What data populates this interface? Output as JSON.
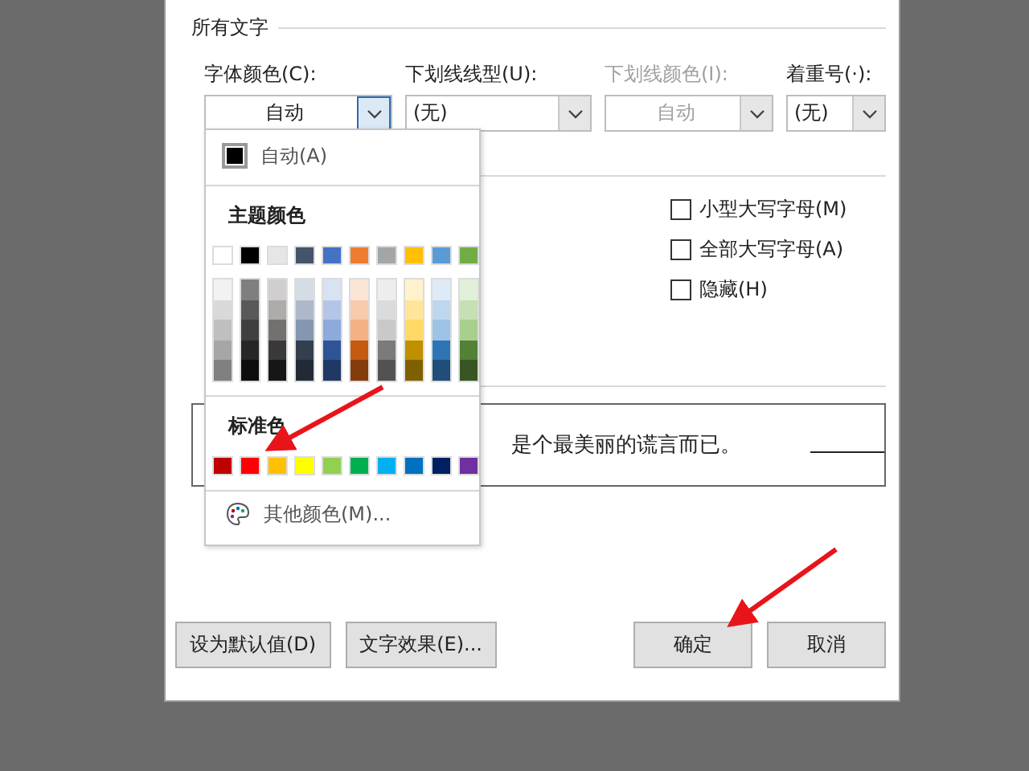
{
  "all_text": {
    "heading": "所有文字",
    "combos": [
      {
        "label": "字体颜色(C):",
        "value": "自动",
        "disabled": false,
        "focused": true,
        "centered": true
      },
      {
        "label": "下划线线型(U):",
        "value": "(无)",
        "disabled": false,
        "focused": false,
        "centered": false
      },
      {
        "label": "下划线颜色(I):",
        "value": "自动",
        "disabled": true,
        "focused": false,
        "centered": true
      },
      {
        "label": "着重号(·):",
        "value": "(无)",
        "disabled": false,
        "focused": false,
        "centered": false
      }
    ]
  },
  "effects": {
    "checkboxes": [
      {
        "label": "小型大写字母(M)",
        "checked": false
      },
      {
        "label": "全部大写字母(A)",
        "checked": false
      },
      {
        "label": "隐藏(H)",
        "checked": false
      }
    ]
  },
  "preview": {
    "text": "是个最美丽的谎言而已。"
  },
  "buttons": [
    {
      "label": "设为默认值(D)",
      "kind": "left"
    },
    {
      "label": "文字效果(E)...",
      "kind": "left"
    },
    {
      "label": "确定",
      "kind": "right"
    },
    {
      "label": "取消",
      "kind": "right"
    }
  ],
  "color_menu": {
    "auto": {
      "label": "自动(A)",
      "color": "#000000"
    },
    "theme_heading": "主题颜色",
    "theme": [
      {
        "color": "#ffffff",
        "shades": [
          {
            "color": "#f2f2f2"
          },
          {
            "color": "#d9d9d9"
          },
          {
            "color": "#bfbfbf"
          },
          {
            "color": "#a6a6a6"
          },
          {
            "color": "#808080"
          }
        ]
      },
      {
        "color": "#000000",
        "shades": [
          {
            "color": "#7f7f7f"
          },
          {
            "color": "#595959"
          },
          {
            "color": "#3f3f3f"
          },
          {
            "color": "#262626"
          },
          {
            "color": "#0d0d0d"
          }
        ]
      },
      {
        "color": "#e7e6e6",
        "shades": [
          {
            "color": "#d0cece"
          },
          {
            "color": "#aeabab"
          },
          {
            "color": "#757070"
          },
          {
            "color": "#3a3838"
          },
          {
            "color": "#171616"
          }
        ]
      },
      {
        "color": "#44546a",
        "shades": [
          {
            "color": "#d6dce4"
          },
          {
            "color": "#adb9ca"
          },
          {
            "color": "#8496b0"
          },
          {
            "color": "#333f4f"
          },
          {
            "color": "#222a35"
          }
        ]
      },
      {
        "color": "#4472c4",
        "shades": [
          {
            "color": "#d9e2f3"
          },
          {
            "color": "#b4c6e7"
          },
          {
            "color": "#8eaadb"
          },
          {
            "color": "#2f5496"
          },
          {
            "color": "#1f3864"
          }
        ]
      },
      {
        "color": "#ed7d31",
        "shades": [
          {
            "color": "#fbe5d5"
          },
          {
            "color": "#f7cbac"
          },
          {
            "color": "#f4b183"
          },
          {
            "color": "#c55a11"
          },
          {
            "color": "#843c0b"
          }
        ]
      },
      {
        "color": "#a5a5a5",
        "shades": [
          {
            "color": "#ededed"
          },
          {
            "color": "#dbdbdb"
          },
          {
            "color": "#c9c9c9"
          },
          {
            "color": "#7b7b7b"
          },
          {
            "color": "#525252"
          }
        ]
      },
      {
        "color": "#ffc000",
        "shades": [
          {
            "color": "#fff2cc"
          },
          {
            "color": "#fee599"
          },
          {
            "color": "#ffd965"
          },
          {
            "color": "#bf9000"
          },
          {
            "color": "#7f6000"
          }
        ]
      },
      {
        "color": "#5b9bd5",
        "shades": [
          {
            "color": "#deebf6"
          },
          {
            "color": "#bdd7ee"
          },
          {
            "color": "#9dc3e6"
          },
          {
            "color": "#2e75b5"
          },
          {
            "color": "#1e4e79"
          }
        ]
      },
      {
        "color": "#70ad47",
        "shades": [
          {
            "color": "#e2efd9"
          },
          {
            "color": "#c5e0b3"
          },
          {
            "color": "#a8d08d"
          },
          {
            "color": "#538135"
          },
          {
            "color": "#375623"
          }
        ]
      }
    ],
    "standard_heading": "标准色",
    "standard": [
      {
        "color": "#c00000"
      },
      {
        "color": "#ff0000"
      },
      {
        "color": "#ffc000"
      },
      {
        "color": "#ffff00"
      },
      {
        "color": "#92d050"
      },
      {
        "color": "#00b050"
      },
      {
        "color": "#00b0f0"
      },
      {
        "color": "#0070c0"
      },
      {
        "color": "#002060"
      },
      {
        "color": "#7030a0"
      }
    ],
    "more": "其他颜色(M)..."
  }
}
